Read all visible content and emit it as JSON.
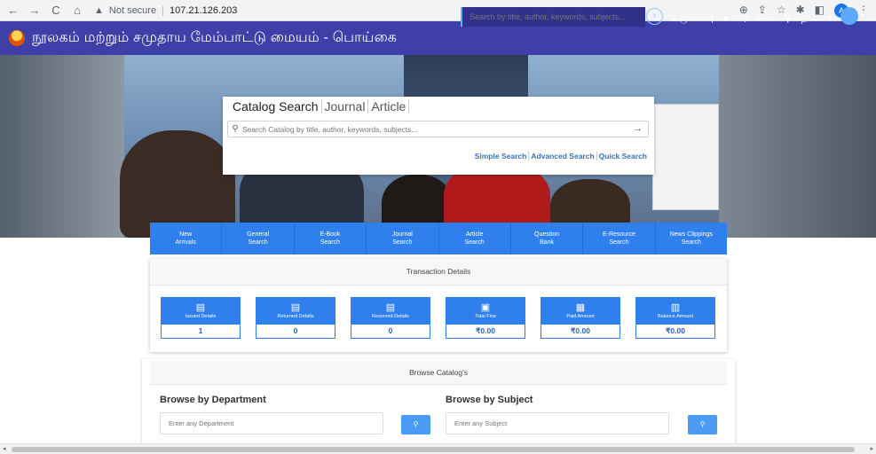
{
  "browser": {
    "nav_back": "←",
    "nav_forward": "→",
    "nav_reload": "C",
    "nav_home": "⌂",
    "security_warning": "Not secure",
    "url": "107.21.126.203",
    "tool_zoom": "⊕",
    "tool_share": "⇪",
    "tool_star": "☆",
    "tool_extensions": "✱",
    "tool_sidebar": "◧",
    "tool_profile": "A",
    "tool_menu": "⋮"
  },
  "header": {
    "title": "நூலகம் மற்றும் சமுதாய மேம்பாட்டு மையம் - பொய்கை",
    "search_placeholder": "Search by title, author, keywords, subjects...",
    "search_button": "›",
    "links": [
      {
        "icon": "⌂",
        "label": "முகப்பு"
      },
      {
        "icon": "●",
        "label": "அரட்டை"
      },
      {
        "icon": "⚲",
        "label": "தேடல்"
      }
    ],
    "links_caret": "▾",
    "user_caret": "▾"
  },
  "search_card": {
    "tabs": [
      "Catalog Search",
      "Journal",
      "Article"
    ],
    "input_placeholder": "Search Catalog by title, author, keywords, subjects...",
    "input_icon": "⚲",
    "submit_icon": "→",
    "links": [
      "Simple Search",
      "Advanced Search",
      "Quick Search"
    ]
  },
  "menu": {
    "items": [
      "New\nArrivals",
      "General\nSearch",
      "E-Book\nSearch",
      "Journal\nSearch",
      "Article\nSearch",
      "Question\nBank",
      "E-Resource\nSearch",
      "News Clippings\nSearch"
    ]
  },
  "transactions": {
    "title": "Transaction Details",
    "items": [
      {
        "label": "Issued Details",
        "value": "1",
        "icon": "book-check-icon"
      },
      {
        "label": "Returned Details",
        "value": "0",
        "icon": "book-return-icon"
      },
      {
        "label": "Reserved Details",
        "value": "0",
        "icon": "book-reserve-icon"
      },
      {
        "label": "Total Fine",
        "value": "₹0.00",
        "icon": "rupee-icon"
      },
      {
        "label": "Paid Amount",
        "value": "₹0.00",
        "icon": "receipt-icon"
      },
      {
        "label": "Balance Amount",
        "value": "₹0.00",
        "icon": "wallet-icon"
      }
    ]
  },
  "browse": {
    "title": "Browse Catalog's",
    "department": {
      "heading": "Browse by Department",
      "placeholder": "Enter any Department",
      "button": "⚲"
    },
    "subject": {
      "heading": "Browse by Subject",
      "placeholder": "Enter any Subject",
      "button": "⚲"
    }
  }
}
